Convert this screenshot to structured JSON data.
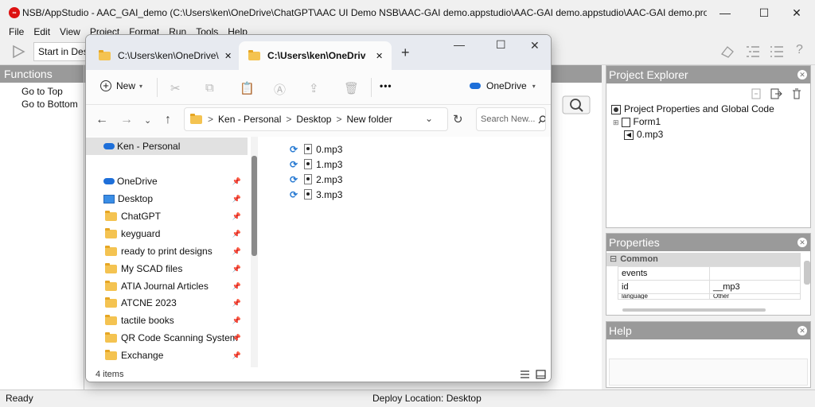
{
  "ide": {
    "title": "NSB/AppStudio - AAC_GAI_demo (C:\\Users\\ken\\OneDrive\\ChatGPT\\AAC UI Demo NSB\\AAC-GAI demo.appstudio\\AAC-GAI demo.appstudio\\AAC-GAI demo.project)",
    "window_controls": {
      "minimize": "—",
      "maximize": "☐",
      "close": "✕"
    },
    "menu": [
      "File",
      "Edit",
      "View",
      "Project",
      "Format",
      "Run",
      "Tools",
      "Help"
    ],
    "toolbar": {
      "run_icon": "play-icon",
      "start_label": "Start in Des",
      "help_icon": "?"
    },
    "functions": {
      "header": "Functions",
      "items": [
        "Go to Top",
        "Go to Bottom"
      ]
    },
    "project_explorer": {
      "header": "Project Explorer",
      "items": [
        "Project Properties and Global Code",
        "Form1",
        "0.mp3"
      ]
    },
    "properties": {
      "header": "Properties",
      "group": "Common",
      "rows": [
        {
          "name": "events",
          "value": ""
        },
        {
          "name": "id",
          "value": "__mp3"
        },
        {
          "name": "language",
          "value": "Other"
        }
      ]
    },
    "help": {
      "header": "Help"
    },
    "status": {
      "left": "Ready",
      "center": "Deploy Location: Desktop"
    }
  },
  "explorer": {
    "tabs": [
      {
        "label": "C:\\Users\\ken\\OneDrive\\",
        "active": false
      },
      {
        "label": "C:\\Users\\ken\\OneDrive\\",
        "active": true
      }
    ],
    "new_tab": "+",
    "window_controls": {
      "minimize": "—",
      "maximize": "☐",
      "close": "✕"
    },
    "command_bar": {
      "new_label": "New",
      "more": "•••",
      "onedrive_label": "OneDrive"
    },
    "address": {
      "breadcrumb": [
        "Ken - Personal",
        "Desktop",
        "New folder"
      ],
      "separator": ">"
    },
    "search": {
      "placeholder": "Search New..."
    },
    "nav": [
      {
        "label": "Ken - Personal",
        "icon": "onedrive-cloud-icon",
        "pinned": false,
        "selected": true
      },
      {
        "label": "OneDrive",
        "icon": "onedrive-cloud-icon",
        "pinned": true
      },
      {
        "label": "Desktop",
        "icon": "desktop-icon",
        "pinned": true
      },
      {
        "label": "ChatGPT",
        "icon": "folder-icon",
        "pinned": true
      },
      {
        "label": "keyguard",
        "icon": "folder-icon",
        "pinned": true
      },
      {
        "label": "ready to print designs",
        "icon": "folder-icon",
        "pinned": true
      },
      {
        "label": "My SCAD files",
        "icon": "folder-icon",
        "pinned": true
      },
      {
        "label": "ATIA Journal Articles",
        "icon": "folder-icon",
        "pinned": true
      },
      {
        "label": "ATCNE 2023",
        "icon": "folder-icon",
        "pinned": true
      },
      {
        "label": "tactile books",
        "icon": "folder-icon",
        "pinned": true
      },
      {
        "label": "QR Code Scanning System",
        "icon": "folder-icon",
        "pinned": true
      },
      {
        "label": "Exchange",
        "icon": "folder-icon",
        "pinned": true
      }
    ],
    "files": [
      "0.mp3",
      "1.mp3",
      "2.mp3",
      "3.mp3"
    ],
    "status": "4 items"
  }
}
